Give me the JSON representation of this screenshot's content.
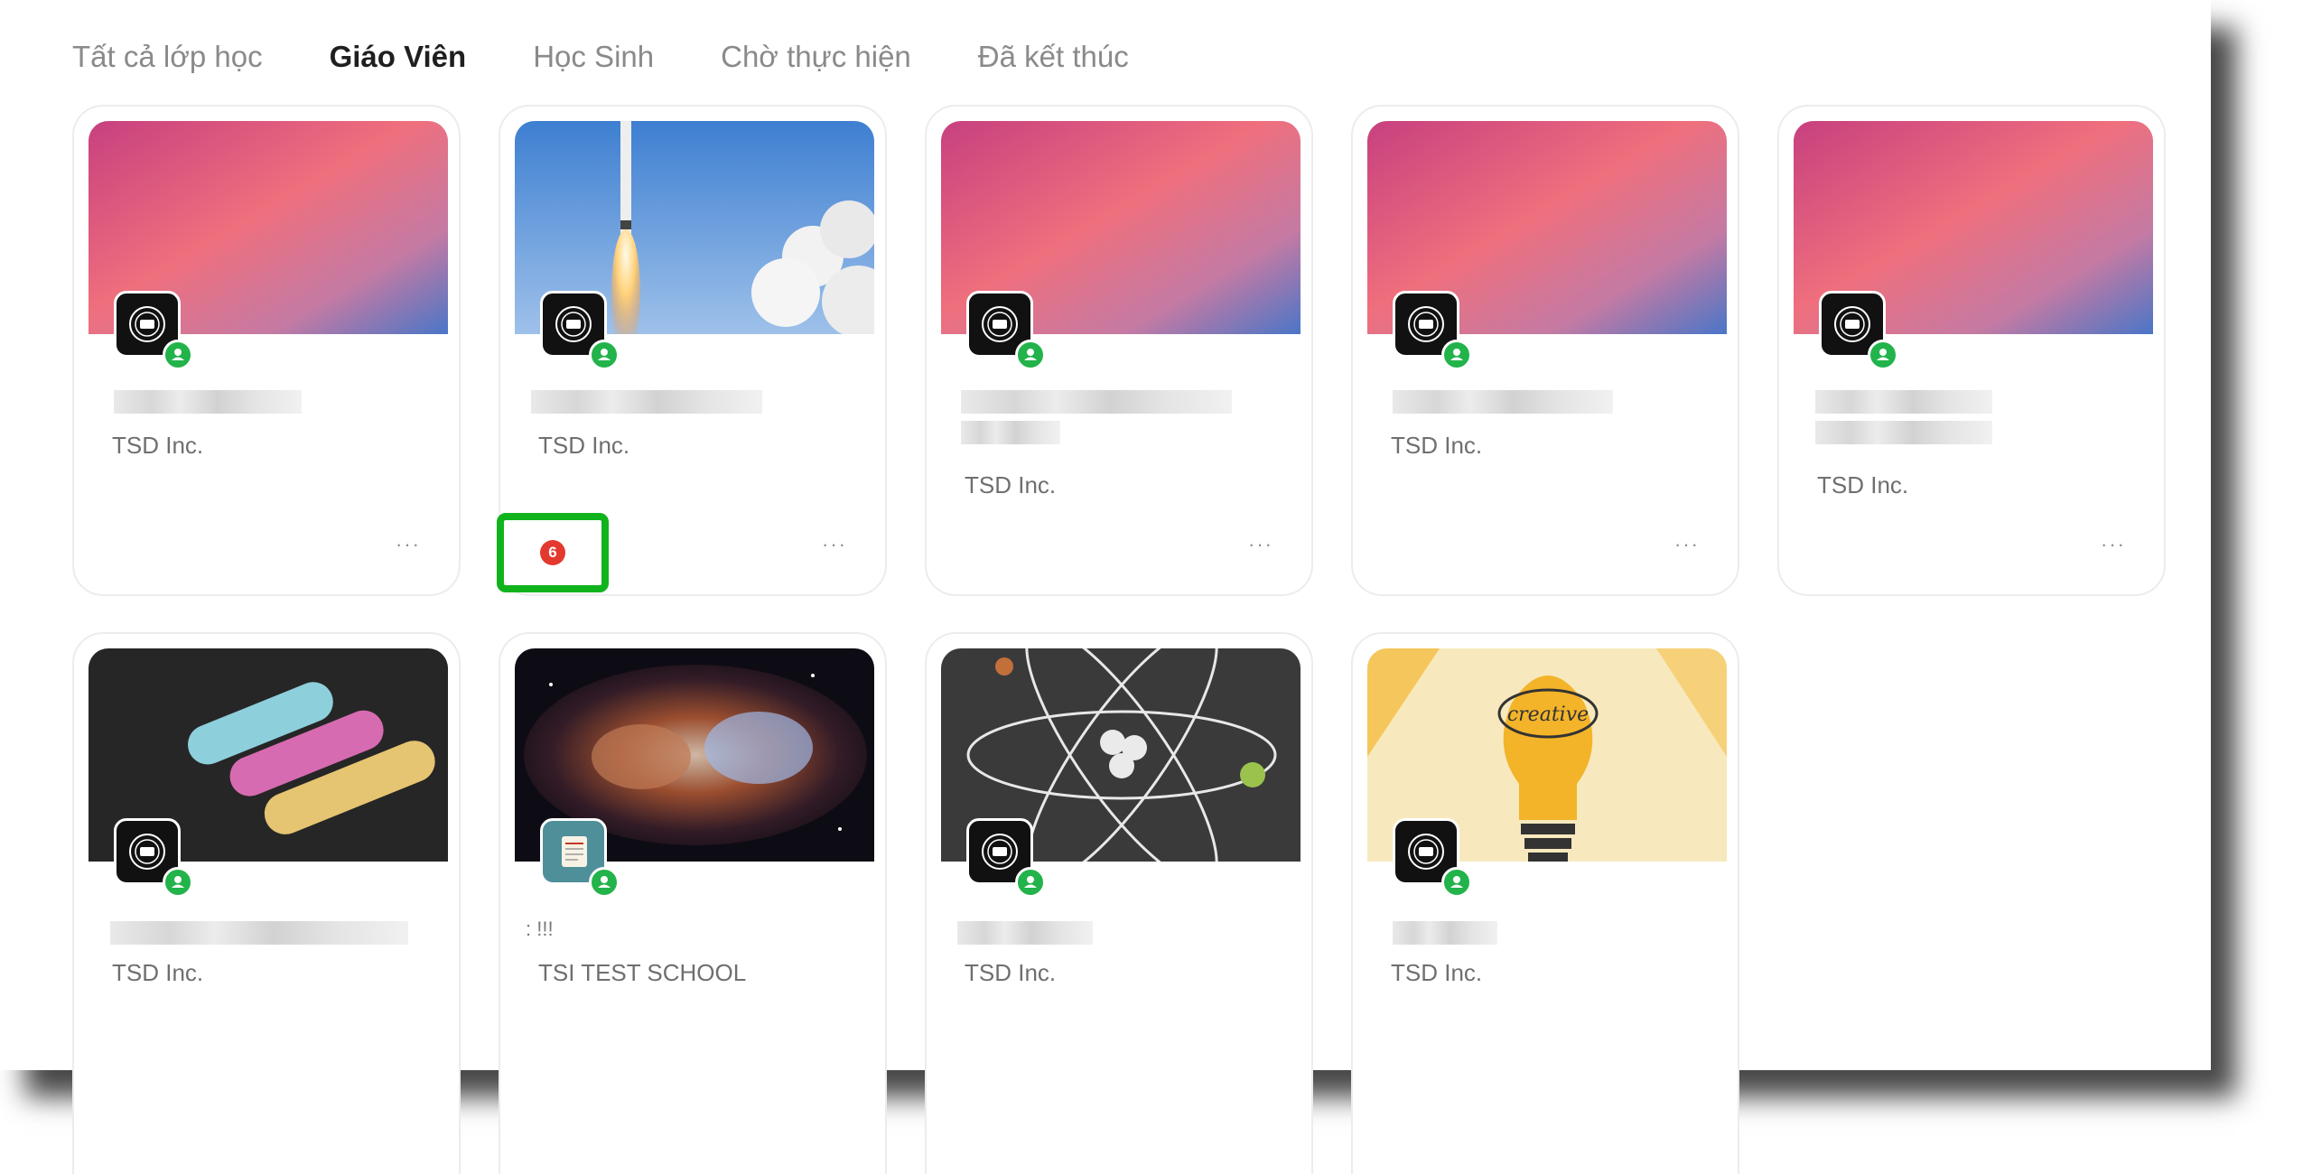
{
  "tabs": [
    {
      "label": "Tất cả lớp học",
      "active": false
    },
    {
      "label": "Giáo Viên",
      "active": true
    },
    {
      "label": "Học Sinh",
      "active": false
    },
    {
      "label": "Chờ thực hiện",
      "active": false
    },
    {
      "label": "Đã kết thúc",
      "active": false
    }
  ],
  "cards": [
    {
      "org": "TSD Inc.",
      "cover": "pink-gradient",
      "more": "···"
    },
    {
      "org": "TSD Inc.",
      "cover": "rocket-launch",
      "more": "···",
      "notification_count": "6"
    },
    {
      "org": "TSD Inc.",
      "cover": "pink-gradient",
      "more": "···"
    },
    {
      "org": "TSD Inc.",
      "cover": "pink-gradient",
      "more": "···"
    },
    {
      "org": "TSD Inc.",
      "cover": "pink-gradient",
      "more": "···"
    },
    {
      "org": "TSD Inc.",
      "cover": "chalk"
    },
    {
      "org": "TSI TEST SCHOOL",
      "cover": "nebula",
      "title_fragment": ": !!!"
    },
    {
      "org": "TSD Inc.",
      "cover": "atom-chalkboard"
    },
    {
      "org": "TSD Inc.",
      "cover": "creative-lightbulb",
      "cover_text": "creative"
    }
  ],
  "colors": {
    "online_badge": "#22b34b",
    "notification": "#e4392f",
    "highlight": "#11b31d"
  }
}
